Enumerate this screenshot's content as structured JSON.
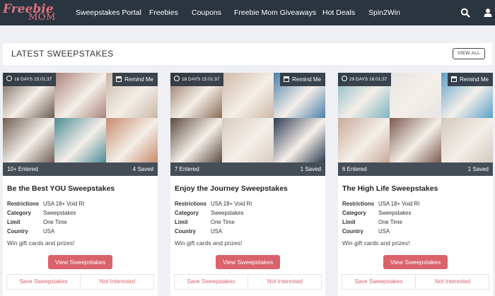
{
  "header": {
    "logo_line1": "Freebie",
    "logo_line2": "MOM",
    "nav": [
      "Sweepstakes Portal",
      "Freebies",
      "Coupons",
      "Freebie Mom Giveaways",
      "Hot Deals",
      "Spin2Win"
    ],
    "icons": [
      "search-icon",
      "user-icon"
    ]
  },
  "section": {
    "title": "LATEST SWEEPSTAKES",
    "view_all": "VIEW ALL"
  },
  "labels": {
    "restrictions": "Restrictions",
    "category": "Category",
    "limit": "Limit",
    "country": "Country",
    "remind": "Remind Me",
    "view_button": "View Sweepstakes",
    "save": "Save Sweepstakes",
    "not_interested": "Not Interested"
  },
  "cards": [
    {
      "timer": "18 DAYS 15:01:37",
      "entered": "10+ Entered",
      "saved": "4 Saved",
      "title": "Be the Best YOU Sweepstakes",
      "restrictions": "USA 18+ Void RI",
      "category": "Sweepstakes",
      "limit": "One Time",
      "country": "USA",
      "description": "Win gift cards and prizes!",
      "image_colors": [
        "#6b5a4e",
        "#a9827a",
        "#c9b7a8",
        "#6f5e55",
        "#4d8b94",
        "#c78b6c"
      ]
    },
    {
      "timer": "18 DAYS 15:01:37",
      "entered": "7 Entered",
      "saved": "1 Saved",
      "title": "Enjoy the Journey Sweepstakes",
      "restrictions": "USA 18+ Void RI",
      "category": "Sweepstakes",
      "limit": "One Time",
      "country": "USA",
      "description": "Win gift cards and prizes!",
      "image_colors": [
        "#8a6a55",
        "#cfb8a6",
        "#4a7fa8",
        "#5a4a3f",
        "#d8cbbf",
        "#2e3b52"
      ]
    },
    {
      "timer": "29 DAYS 16:01:37",
      "entered": "6 Entered",
      "saved": "1 Saved",
      "title": "The High Life Sweepstakes",
      "restrictions": "USA 18+ Void RI",
      "category": "Sweepstakes",
      "limit": "One Time",
      "country": "USA",
      "description": "Win gift cards and prizes!",
      "image_colors": [
        "#7fb3bf",
        "#e6e4e2",
        "#5a9fc9",
        "#c9a99a",
        "#7a5a4e",
        "#d3c8bf"
      ]
    }
  ]
}
